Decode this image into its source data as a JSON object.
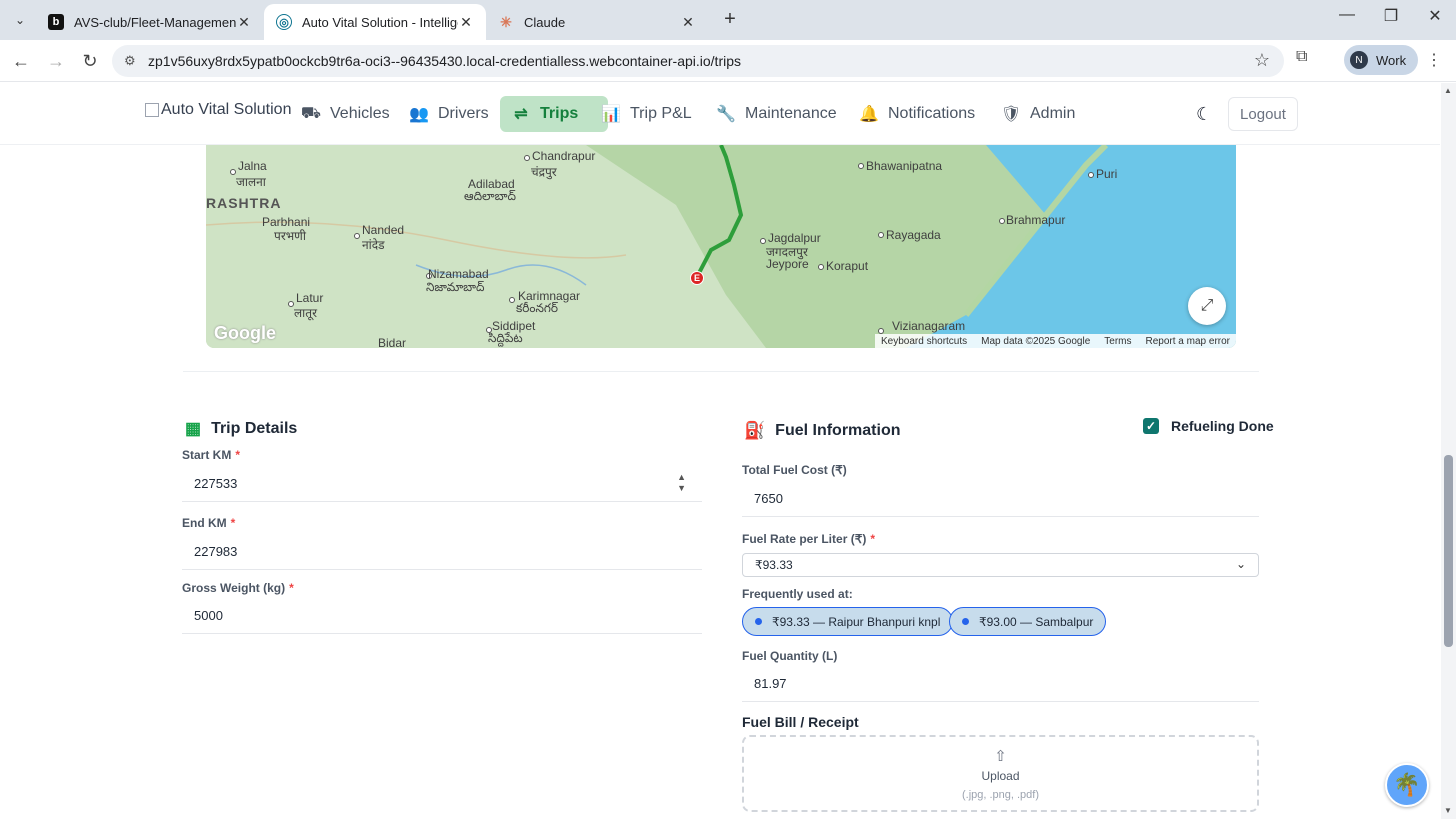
{
  "browser": {
    "tabs": [
      {
        "title": "AVS-club/Fleet-Management-S",
        "favicon": "b",
        "favicon_color": "#111111"
      },
      {
        "title": "Auto Vital Solution - Intelligent",
        "favicon": "◎",
        "favicon_color": "#0e7490"
      },
      {
        "title": "Claude",
        "favicon": "✳",
        "favicon_color": "#d97757"
      }
    ],
    "url": "zp1v56uxy8rdx5ypatb0ockcb9tr6a-oci3--96435430.local-credentialless.webcontainer-api.io/trips",
    "profile_initial": "N",
    "profile_name": "Work"
  },
  "nav": {
    "logo_alt": "Auto Vital Solution",
    "items": [
      {
        "label": "Vehicles",
        "icon": "truck-icon",
        "glyph": "⛟"
      },
      {
        "label": "Drivers",
        "icon": "users-icon",
        "glyph": "👥"
      },
      {
        "label": "Trips",
        "icon": "route-icon",
        "glyph": "⇌"
      },
      {
        "label": "Trip P&L",
        "icon": "bar-chart-icon",
        "glyph": "📊"
      },
      {
        "label": "Maintenance",
        "icon": "wrench-icon",
        "glyph": "🔧"
      },
      {
        "label": "Notifications",
        "icon": "bell-icon",
        "glyph": "🔔"
      },
      {
        "label": "Admin",
        "icon": "shield-icon",
        "glyph": "🛡"
      }
    ],
    "active": "Trips",
    "logout_label": "Logout"
  },
  "map": {
    "labels": {
      "chandrapur": "Chandrapur",
      "chandrapur_local": "चंद्रपुर",
      "bhawanipatna": "Bhawanipatna",
      "puri": "Puri",
      "jalna": "Jalna",
      "jalna_local": "जालना",
      "rashtra": "RASHTRA",
      "adilabad": "Adilabad",
      "adilabad_local": "ఆదిలాబాద్",
      "jagdalpur": "Jagdalpur",
      "jagdalpur_local": "जगदलपुर",
      "brahmapur": "Brahmapur",
      "rayagada": "Rayagada",
      "parbhani": "Parbhani",
      "parbhani_local": "परभणी",
      "nanded": "Nanded",
      "nanded_local": "नांदेड",
      "jeypore": "Jeypore",
      "koraput": "Koraput",
      "nizamabad": "Nizamabad",
      "nizamabad_local": "నిజామాబాద్",
      "karimnagar": "Karimnagar",
      "karimnagar_local": "కరీంనగర్",
      "latur": "Latur",
      "latur_local": "लातूर",
      "siddipet": "Siddipet",
      "siddipet_local": "సిద్దిపేట",
      "bidar": "Bidar",
      "vizianagaram": "Vizianagaram"
    },
    "marker_label": "E",
    "google": "Google",
    "attribution": [
      "Keyboard shortcuts",
      "Map data ©2025 Google",
      "Terms",
      "Report a map error"
    ]
  },
  "trip_details": {
    "title": "Trip Details",
    "start_km_label": "Start KM",
    "start_km": "227533",
    "end_km_label": "End KM",
    "end_km": "227983",
    "gross_weight_label": "Gross Weight (kg)",
    "gross_weight": "5000",
    "required_mark": "*"
  },
  "fuel": {
    "title": "Fuel Information",
    "refueling_label": "Refueling Done",
    "refueling_checked": true,
    "total_cost_label": "Total Fuel Cost (₹)",
    "total_cost": "7650",
    "rate_label": "Fuel Rate per Liter (₹)",
    "rate_selected": "₹93.33",
    "frequent_label": "Frequently used at:",
    "chips": [
      "₹93.33 — Raipur Bhanpuri knpl",
      "₹93.00 — Sambalpur"
    ],
    "quantity_label": "Fuel Quantity (L)",
    "quantity": "81.97",
    "bill_label": "Fuel Bill / Receipt",
    "upload_label": "Upload",
    "upload_hint": "(.jpg, .png, .pdf)"
  }
}
